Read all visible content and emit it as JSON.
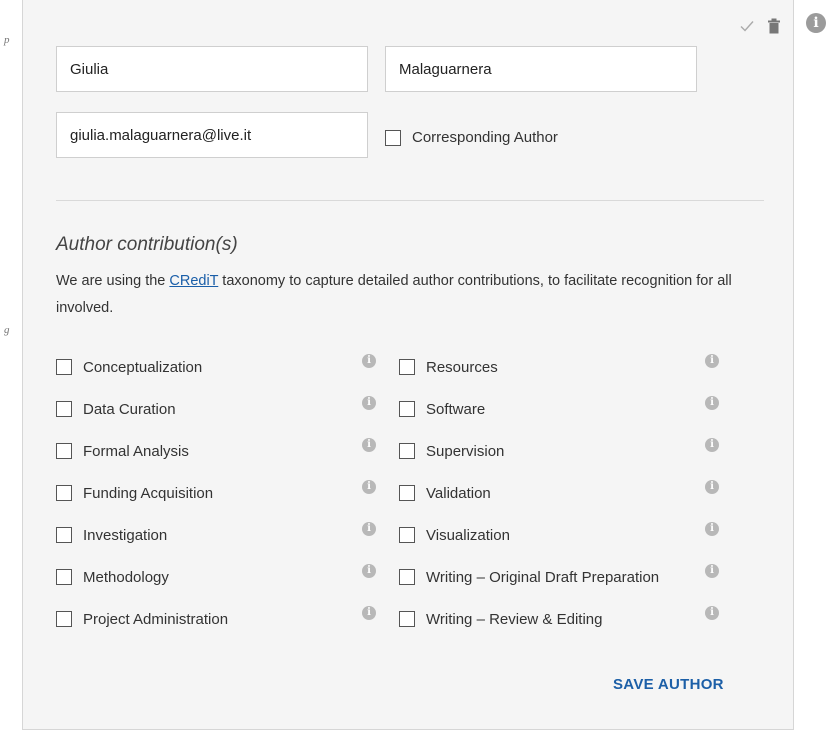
{
  "form": {
    "first_name": "Giulia",
    "last_name": "Malaguarnera",
    "email": "giulia.malaguarnera@live.it",
    "corresponding_label": "Corresponding Author"
  },
  "contrib": {
    "heading": "Author contribution(s)",
    "desc_pre": "We are using the ",
    "link_text": "CRediT",
    "desc_post": " taxonomy to capture detailed author contributions, to facilitate recognition for all involved.",
    "left": [
      "Conceptualization",
      "Data Curation",
      "Formal Analysis",
      "Funding Acquisition",
      "Investigation",
      "Methodology",
      "Project Administration"
    ],
    "right": [
      "Resources",
      "Software",
      "Supervision",
      "Validation",
      "Visualization",
      "Writing – Original Draft Preparation",
      "Writing – Review & Editing"
    ]
  },
  "save_label": "SAVE AUTHOR",
  "edge_marks": [
    "p",
    "g"
  ],
  "info_glyph": "i",
  "colors": {
    "accent": "#1c5fa7",
    "link": "#1a5ea8",
    "panel": "#f5f5f5"
  }
}
